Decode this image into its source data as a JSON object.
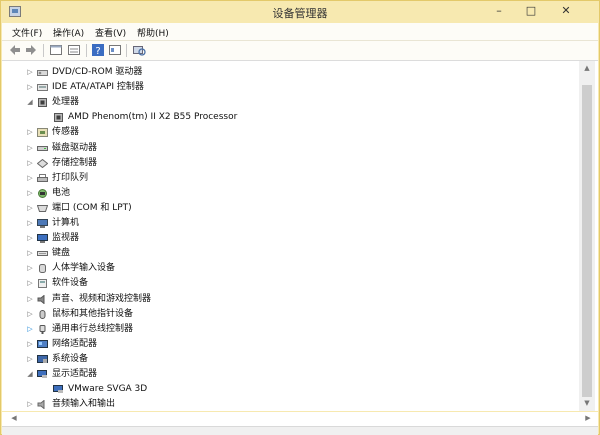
{
  "window": {
    "title": "设备管理器",
    "controls": {
      "minimize": "–",
      "maximize": "□",
      "close": "✕"
    }
  },
  "menu": [
    "文件(F)",
    "操作(A)",
    "查看(V)",
    "帮助(H)"
  ],
  "toolbar": [
    {
      "icon": "back-arrow-icon"
    },
    {
      "icon": "forward-arrow-icon"
    },
    {
      "icon": "properties-icon"
    },
    {
      "icon": "device-list-icon"
    },
    {
      "icon": "help-icon"
    },
    {
      "icon": "details-icon"
    },
    {
      "icon": "scan-hardware-icon"
    }
  ],
  "tree": [
    {
      "label": "DVD/CD-ROM 驱动器",
      "level": 0,
      "state": "collapsed",
      "icon": "dvd-drive-icon"
    },
    {
      "label": "IDE ATA/ATAPI 控制器",
      "level": 0,
      "state": "collapsed",
      "icon": "ide-controller-icon"
    },
    {
      "label": "处理器",
      "level": 0,
      "state": "expanded",
      "icon": "processor-icon"
    },
    {
      "label": "AMD Phenom(tm) II X2 B55 Processor",
      "level": 1,
      "state": "leaf",
      "icon": "processor-icon"
    },
    {
      "label": "传感器",
      "level": 0,
      "state": "collapsed",
      "icon": "sensor-icon"
    },
    {
      "label": "磁盘驱动器",
      "level": 0,
      "state": "collapsed",
      "icon": "disk-drive-icon"
    },
    {
      "label": "存储控制器",
      "level": 0,
      "state": "collapsed",
      "icon": "storage-controller-icon"
    },
    {
      "label": "打印队列",
      "level": 0,
      "state": "collapsed",
      "icon": "printer-icon"
    },
    {
      "label": "电池",
      "level": 0,
      "state": "collapsed",
      "icon": "battery-icon"
    },
    {
      "label": "端口 (COM 和 LPT)",
      "level": 0,
      "state": "collapsed",
      "icon": "port-icon"
    },
    {
      "label": "计算机",
      "level": 0,
      "state": "collapsed",
      "icon": "computer-icon"
    },
    {
      "label": "监视器",
      "level": 0,
      "state": "collapsed",
      "icon": "monitor-icon"
    },
    {
      "label": "键盘",
      "level": 0,
      "state": "collapsed",
      "icon": "keyboard-icon"
    },
    {
      "label": "人体学输入设备",
      "level": 0,
      "state": "collapsed",
      "icon": "hid-icon"
    },
    {
      "label": "软件设备",
      "level": 0,
      "state": "collapsed",
      "icon": "software-device-icon"
    },
    {
      "label": "声音、视频和游戏控制器",
      "level": 0,
      "state": "collapsed",
      "icon": "speaker-icon"
    },
    {
      "label": "鼠标和其他指针设备",
      "level": 0,
      "state": "collapsed",
      "icon": "mouse-icon"
    },
    {
      "label": "通用串行总线控制器",
      "level": 0,
      "state": "collapsed-highlight",
      "icon": "usb-icon"
    },
    {
      "label": "网络适配器",
      "level": 0,
      "state": "collapsed",
      "icon": "network-adapter-icon"
    },
    {
      "label": "系统设备",
      "level": 0,
      "state": "collapsed",
      "icon": "system-device-icon"
    },
    {
      "label": "显示适配器",
      "level": 0,
      "state": "expanded",
      "icon": "display-adapter-icon"
    },
    {
      "label": "VMware SVGA 3D",
      "level": 1,
      "state": "leaf",
      "icon": "display-adapter-icon"
    },
    {
      "label": "音频输入和输出",
      "level": 0,
      "state": "collapsed",
      "icon": "audio-icon"
    }
  ],
  "scrollbars": {
    "up": "▲",
    "down": "▼",
    "left": "◀",
    "right": "▶"
  }
}
